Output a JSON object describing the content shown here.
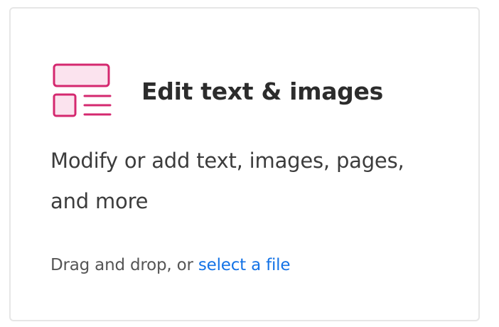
{
  "card": {
    "title": "Edit text & images",
    "description": "Modify or add text, images, pages, and more",
    "dropzone_prefix": "Drag and drop, or ",
    "select_link": "select a file",
    "icon": "edit-text-images-icon"
  },
  "colors": {
    "icon_stroke": "#d4286f",
    "icon_fill": "#fbe3ee",
    "link": "#1473e6",
    "title": "#2c2c2c",
    "body": "#3c3c3c",
    "border": "#e6e6e6"
  }
}
